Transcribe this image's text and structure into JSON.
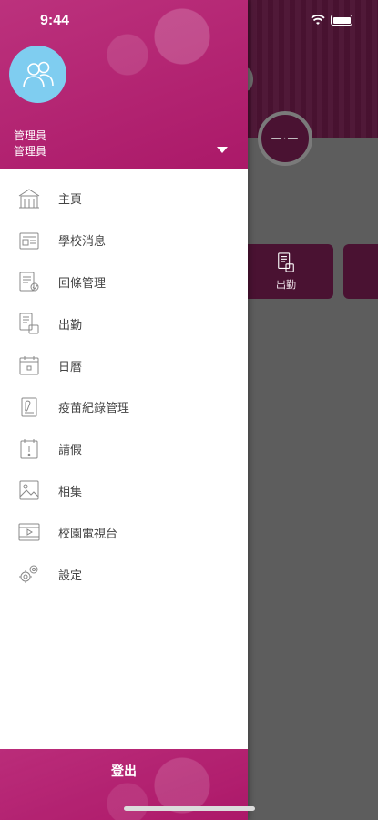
{
  "status_bar": {
    "time": "9:44"
  },
  "user": {
    "name": "管理員",
    "role": "管理員"
  },
  "menu": {
    "items": [
      {
        "label": "主頁",
        "icon": "school-icon"
      },
      {
        "label": "學校消息",
        "icon": "news-icon"
      },
      {
        "label": "回條管理",
        "icon": "reply-slip-icon"
      },
      {
        "label": "出勤",
        "icon": "attendance-icon"
      },
      {
        "label": "日曆",
        "icon": "calendar-icon"
      },
      {
        "label": "疫苗紀錄管理",
        "icon": "vaccine-record-icon"
      },
      {
        "label": "請假",
        "icon": "leave-icon"
      },
      {
        "label": "相集",
        "icon": "album-icon"
      },
      {
        "label": "校園電視台",
        "icon": "tv-icon"
      },
      {
        "label": "設定",
        "icon": "settings-icon"
      }
    ]
  },
  "logout": {
    "label": "登出"
  },
  "background": {
    "tile_label": "出勤"
  },
  "colors": {
    "brand": "#b41a6e",
    "avatar": "#7fcdf0",
    "overlay": "#5d5d5d"
  }
}
